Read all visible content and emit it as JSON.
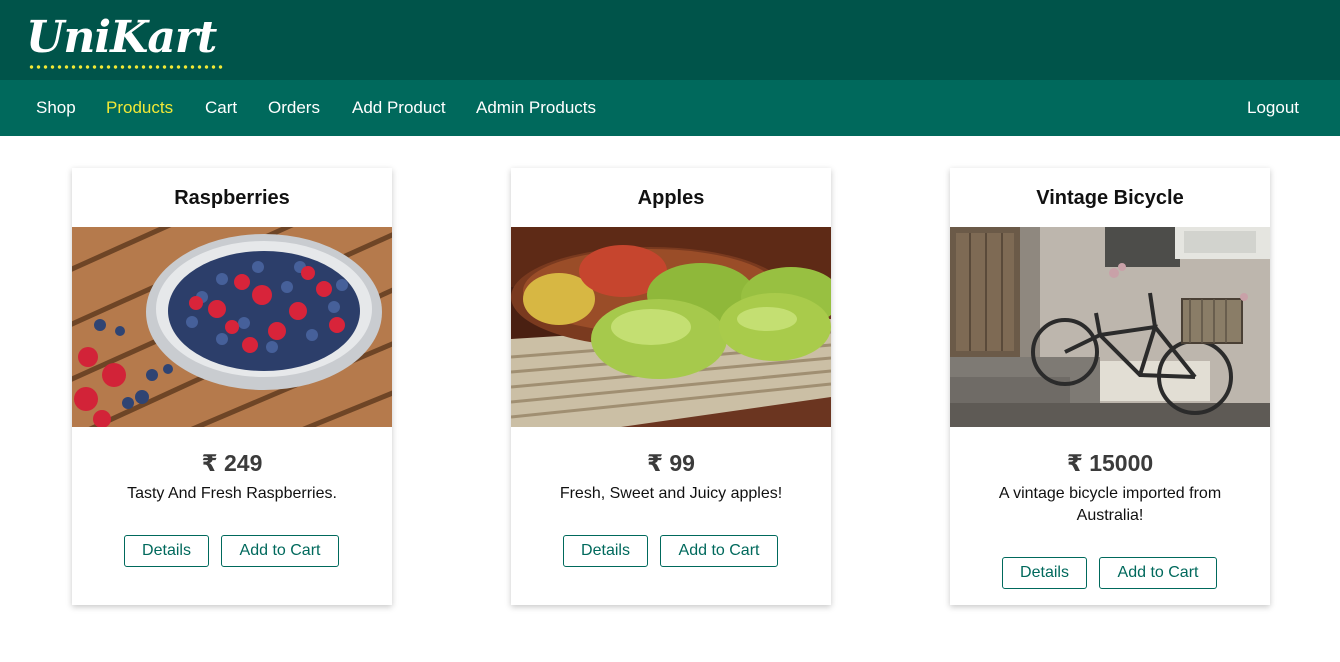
{
  "brand": {
    "name": "UniKart"
  },
  "nav": {
    "items": [
      {
        "label": "Shop"
      },
      {
        "label": "Products"
      },
      {
        "label": "Cart"
      },
      {
        "label": "Orders"
      },
      {
        "label": "Add Product"
      },
      {
        "label": "Admin Products"
      }
    ],
    "active": "Products",
    "logout_label": "Logout"
  },
  "products": [
    {
      "title": "Raspberries",
      "price": "₹ 249",
      "description": "Tasty And Fresh Raspberries.",
      "details_label": "Details",
      "cart_label": "Add to Cart"
    },
    {
      "title": "Apples",
      "price": "₹ 99",
      "description": "Fresh, Sweet and Juicy apples!",
      "details_label": "Details",
      "cart_label": "Add to Cart"
    },
    {
      "title": "Vintage Bicycle",
      "price": "₹ 15000",
      "description": "A vintage bicycle imported from Australia!",
      "details_label": "Details",
      "cart_label": "Add to Cart"
    }
  ],
  "colors": {
    "header_bg": "#00544a",
    "nav_bg": "#00695c",
    "active_nav": "#f1e836",
    "button_border": "#00695c"
  }
}
